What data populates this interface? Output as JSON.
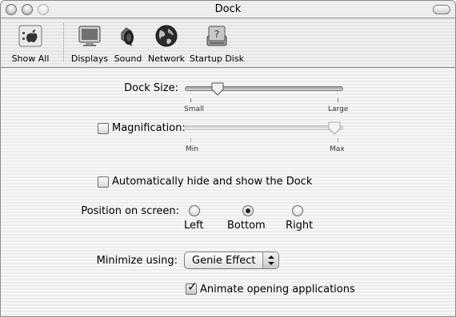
{
  "window": {
    "title": "Dock"
  },
  "toolbar": {
    "items": [
      {
        "label": "Show All",
        "icon": "apple-icon"
      },
      {
        "label": "Displays",
        "icon": "display-icon"
      },
      {
        "label": "Sound",
        "icon": "speaker-icon"
      },
      {
        "label": "Network",
        "icon": "globe-icon"
      },
      {
        "label": "Startup Disk",
        "icon": "disk-icon"
      }
    ]
  },
  "dock_size": {
    "label": "Dock Size:",
    "min_label": "Small",
    "max_label": "Large",
    "value": 0.17
  },
  "magnification": {
    "label": "Magnification:",
    "checked": false,
    "min_label": "Min",
    "max_label": "Max",
    "value": 1.0,
    "enabled": false
  },
  "autohide": {
    "label": "Automatically hide and show the Dock",
    "checked": false
  },
  "position": {
    "label": "Position on screen:",
    "options": [
      "Left",
      "Bottom",
      "Right"
    ],
    "selected": "Bottom"
  },
  "minimize": {
    "label": "Minimize using:",
    "value": "Genie Effect"
  },
  "animate": {
    "label": "Animate opening applications",
    "checked": true
  }
}
